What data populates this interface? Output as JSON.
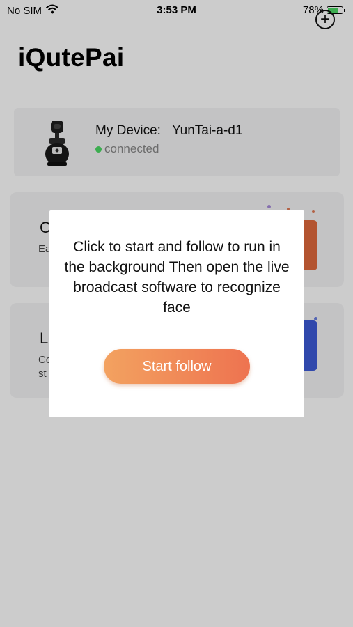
{
  "status_bar": {
    "carrier": "No SIM",
    "time": "3:53 PM",
    "battery": "78%",
    "battery_level": 0.78,
    "icons": [
      "wifi-icon",
      "battery-icon"
    ]
  },
  "header": {
    "title": "iQutePai",
    "add_icon": "plus-circle-icon"
  },
  "device": {
    "label": "My Device:",
    "name": "YunTai-a-d1",
    "status": "connected",
    "status_color": "#4cd964"
  },
  "cards": [
    {
      "title": "C",
      "description": "Ea"
    },
    {
      "title": "L",
      "description": "Cc\nst"
    }
  ],
  "modal": {
    "message": "Click to start and follow to run in the background Then open the live broadcast software to recognize face",
    "button_label": "Start follow",
    "button_gradient": [
      "#f3a260",
      "#ee7350"
    ]
  },
  "colors": {
    "overlay": "rgba(0,0,0,0.2)",
    "card_background": "#f4f4f5"
  }
}
